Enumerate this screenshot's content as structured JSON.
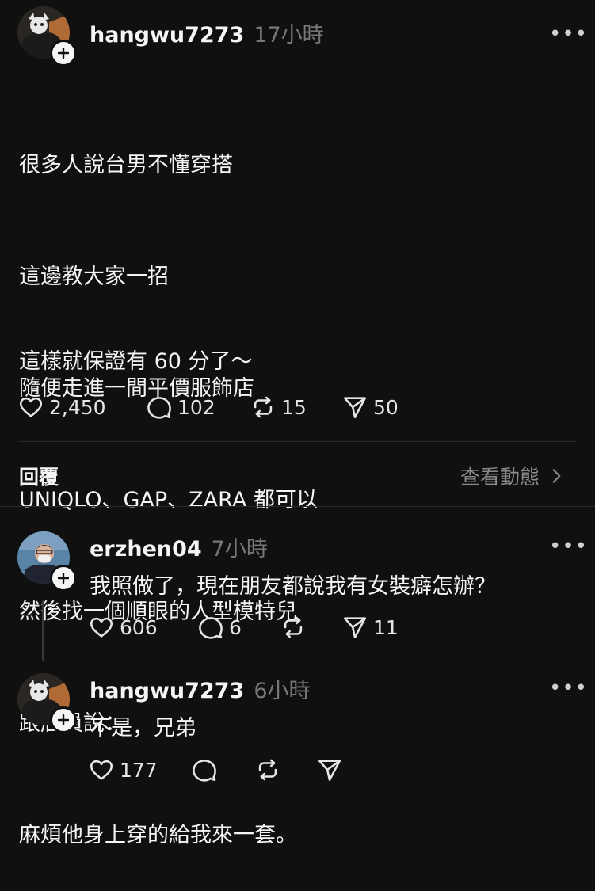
{
  "post": {
    "username": "hangwu7273",
    "time": "17小時",
    "body_lines": [
      "很多人說台男不懂穿搭",
      "這邊教大家一招",
      "隨便走進一間平價服飾店",
      "UNIQLO、GAP、ZARA 都可以",
      "然後找一個順眼的人型模特兒",
      "跟店員說：",
      "麻煩他身上穿的給我來一套。"
    ],
    "body_last": "這樣就保證有 60 分了～",
    "likes": "2,450",
    "comments": "102",
    "reposts": "15",
    "shares": "50"
  },
  "replies_bar": {
    "label": "回覆",
    "activity_link": "查看動態"
  },
  "reply1": {
    "username": "erzhen04",
    "time": "7小時",
    "text": "我照做了，現在朋友都說我有女裝癖怎辦？",
    "likes": "606",
    "comments": "6",
    "shares": "11"
  },
  "reply2": {
    "username": "hangwu7273",
    "time": "6小時",
    "text": "不是，兄弟",
    "likes": "177"
  },
  "more_glyph": "•••",
  "colors": {
    "background": "#101010",
    "text": "#f3f5f7",
    "muted": "#777777",
    "divider": "#2a2a2a"
  }
}
